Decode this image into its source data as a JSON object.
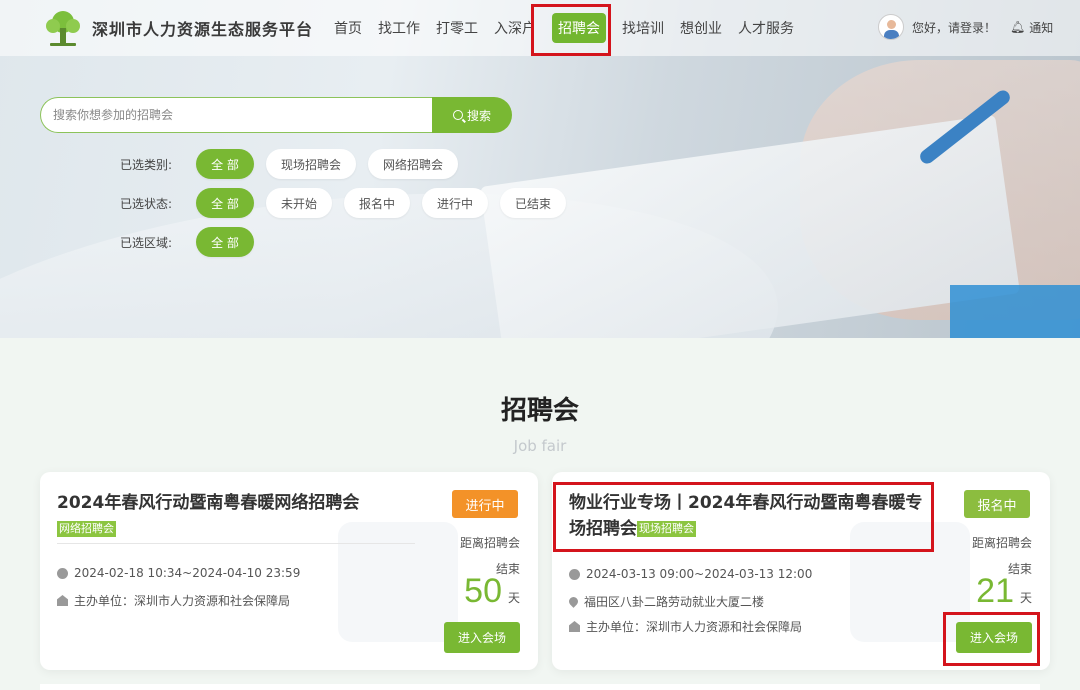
{
  "header": {
    "logo_text": "深圳市人力资源生态服务平台",
    "nav": [
      "首页",
      "找工作",
      "打零工",
      "入深户",
      "招聘会",
      "找培训",
      "想创业",
      "人才服务"
    ],
    "active_index": 4,
    "login_text": "您好，请登录！",
    "notice_text": "通知"
  },
  "search": {
    "placeholder": "搜索你想参加的招聘会",
    "button_label": "搜索"
  },
  "filters": [
    {
      "label": "已选类别:",
      "options": [
        "全 部",
        "现场招聘会",
        "网络招聘会"
      ]
    },
    {
      "label": "已选状态:",
      "options": [
        "全 部",
        "未开始",
        "报名中",
        "进行中",
        "已结束"
      ]
    },
    {
      "label": "已选区域:",
      "options": [
        "全 部"
      ]
    }
  ],
  "section": {
    "title": "招聘会",
    "subtitle": "Job fair"
  },
  "cards": [
    {
      "title": "2024年春风行动暨南粤春暖网络招聘会",
      "tag": "网络招聘会",
      "status": "进行中",
      "time": "2024-02-18 10:34~2024-04-10 23:59",
      "organizer": "主办单位：深圳市人力资源和社会保障局",
      "distance_label": "距离招聘会",
      "distance_label2": "结束",
      "days": "50",
      "days_unit": "天",
      "button": "进入会场"
    },
    {
      "title": "物业行业专场丨2024年春风行动暨南粤春暖专场招聘会",
      "tag": "现场招聘会",
      "status": "报名中",
      "time": "2024-03-13 09:00~2024-03-13 12:00",
      "address": "福田区八卦二路劳动就业大厦二楼",
      "organizer": "主办单位：深圳市人力资源和社会保障局",
      "distance_label": "距离招聘会",
      "distance_label2": "结束",
      "days": "21",
      "days_unit": "天",
      "button": "进入会场"
    }
  ],
  "colors": {
    "accent": "#79b833",
    "ongoing": "#f39228",
    "highlight": "#d4141c"
  }
}
